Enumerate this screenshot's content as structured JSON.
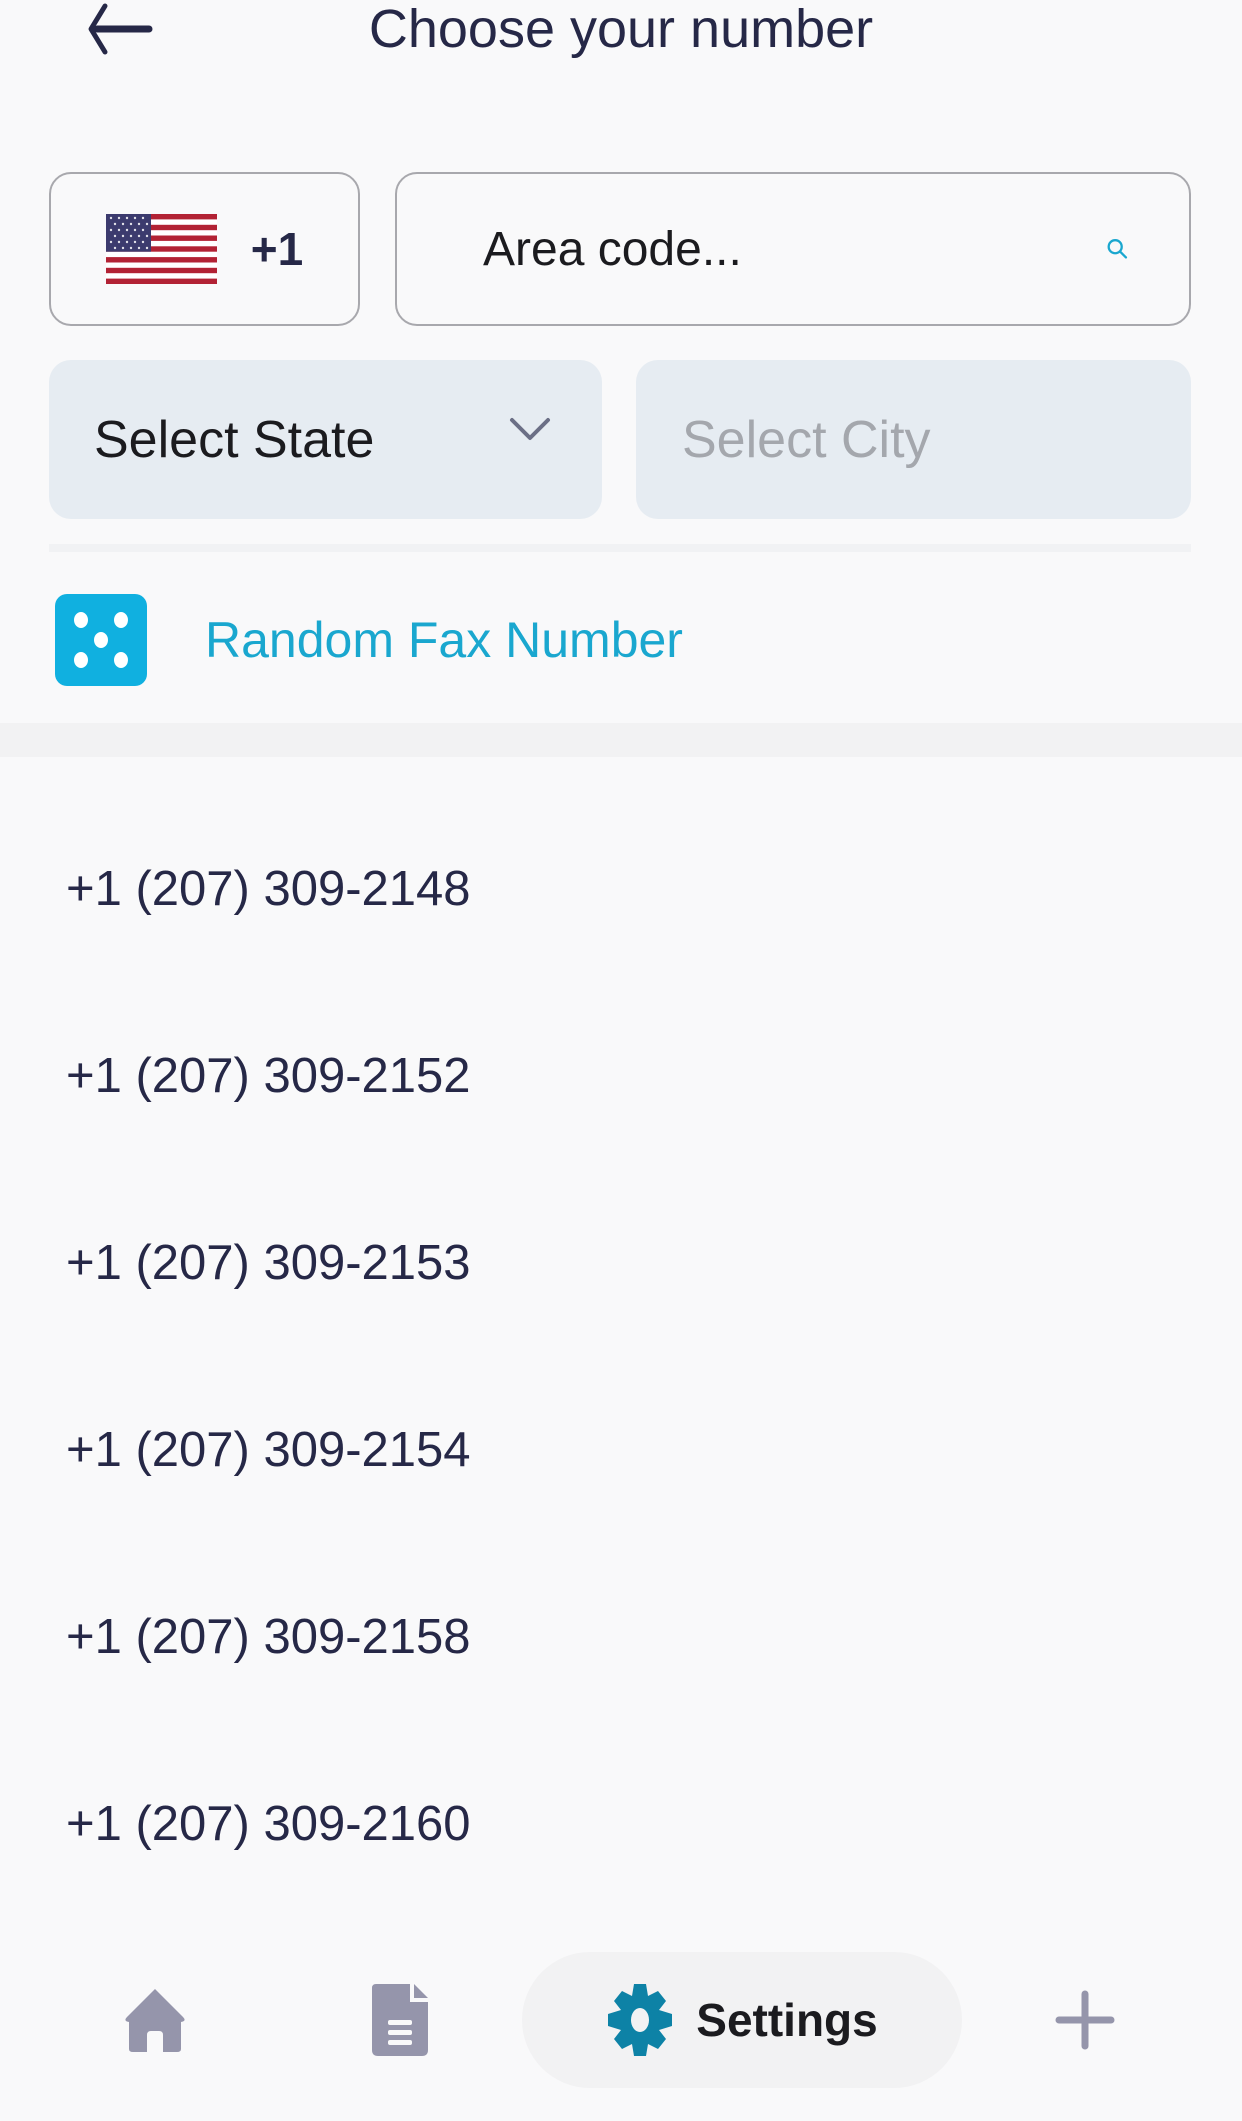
{
  "header": {
    "title": "Choose your number",
    "back_icon": "arrow-left-icon"
  },
  "country": {
    "flag_icon": "us-flag-icon",
    "dial_code": "+1"
  },
  "search": {
    "placeholder": "Area code...",
    "value": "",
    "icon": "search-icon"
  },
  "filters": {
    "state": {
      "label": "Select State",
      "icon": "chevron-down-icon"
    },
    "city": {
      "label": "Select City",
      "disabled": true
    }
  },
  "random": {
    "icon": "dice-icon",
    "label": "Random Fax Number"
  },
  "numbers": [
    "+1 (207) 309-2148",
    "+1 (207) 309-2152",
    "+1 (207) 309-2153",
    "+1 (207) 309-2154",
    "+1 (207) 309-2158",
    "+1 (207) 309-2160"
  ],
  "bottom_nav": {
    "items": [
      {
        "name": "home",
        "icon": "home-icon"
      },
      {
        "name": "documents",
        "icon": "document-icon"
      },
      {
        "name": "settings",
        "icon": "gear-icon",
        "label": "Settings",
        "active": true
      },
      {
        "name": "add",
        "icon": "plus-icon"
      }
    ]
  },
  "colors": {
    "accent": "#1aa7cf",
    "text_dark": "#262847",
    "nav_inactive": "#9595ab",
    "settings_gear": "#0d82a6",
    "select_bg": "#e6ecf2"
  }
}
